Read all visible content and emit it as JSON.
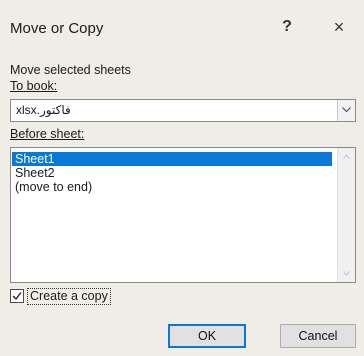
{
  "dialog": {
    "title": "Move or Copy",
    "help_label": "?",
    "close_label": "×"
  },
  "move_label": "Move selected sheets",
  "to_book": {
    "label": "To book:",
    "value": "فاكتور.xlsx"
  },
  "before_sheet": {
    "label": "Before sheet:",
    "items": [
      "Sheet1",
      "Sheet2",
      "(move to end)"
    ],
    "selected_index": 0
  },
  "create_copy": {
    "label": "Create a copy",
    "checked": true
  },
  "buttons": {
    "ok": "OK",
    "cancel": "Cancel"
  },
  "colors": {
    "selection": "#0a78d6",
    "background": "#f0ede6"
  }
}
